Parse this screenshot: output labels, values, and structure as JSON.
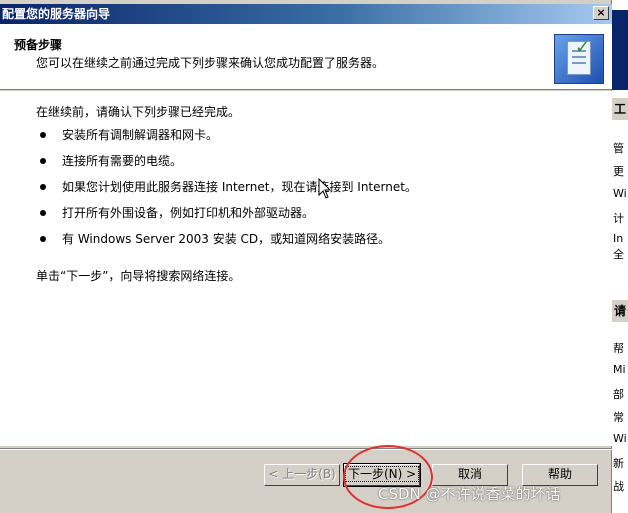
{
  "window": {
    "title": "配置您的服务器向导",
    "close_glyph": "×"
  },
  "header": {
    "title": "预备步骤",
    "subtitle": "您可以在继续之前通过完成下列步骤来确认您成功配置了服务器。"
  },
  "body": {
    "intro": "在继续前，请确认下列步骤已经完成。",
    "steps": [
      "安装所有调制解调器和网卡。",
      "连接所有需要的电缆。",
      "如果您计划使用此服务器连接 Internet，现在请连接到 Internet。",
      "打开所有外围设备，例如打印机和外部驱动器。",
      "有 Windows Server 2003 安装 CD，或知道网络安装路径。"
    ],
    "note": "单击“下一步”，向导将搜索网络连接。"
  },
  "buttons": {
    "back": "< 上一步(B)",
    "next": "下一步(N) >",
    "cancel": "取消",
    "help": "帮助"
  },
  "background_window": {
    "section1": "工",
    "lines1": [
      "管",
      "更",
      "Wi",
      "计",
      "In",
      "全"
    ],
    "section2": "请",
    "lines2": [
      "帮",
      "Mi",
      "部",
      "常",
      "Wi",
      "新",
      "战"
    ]
  },
  "watermark": "CSDN @不许说香菜的坏话",
  "colors": {
    "titlebar_start": "#0a246a",
    "titlebar_end": "#a6caf0",
    "dialog_face": "#d4d0c8",
    "annotation": "#e03030"
  },
  "icons": [
    "close-icon",
    "wizard-checklist-icon",
    "mouse-cursor-icon"
  ]
}
